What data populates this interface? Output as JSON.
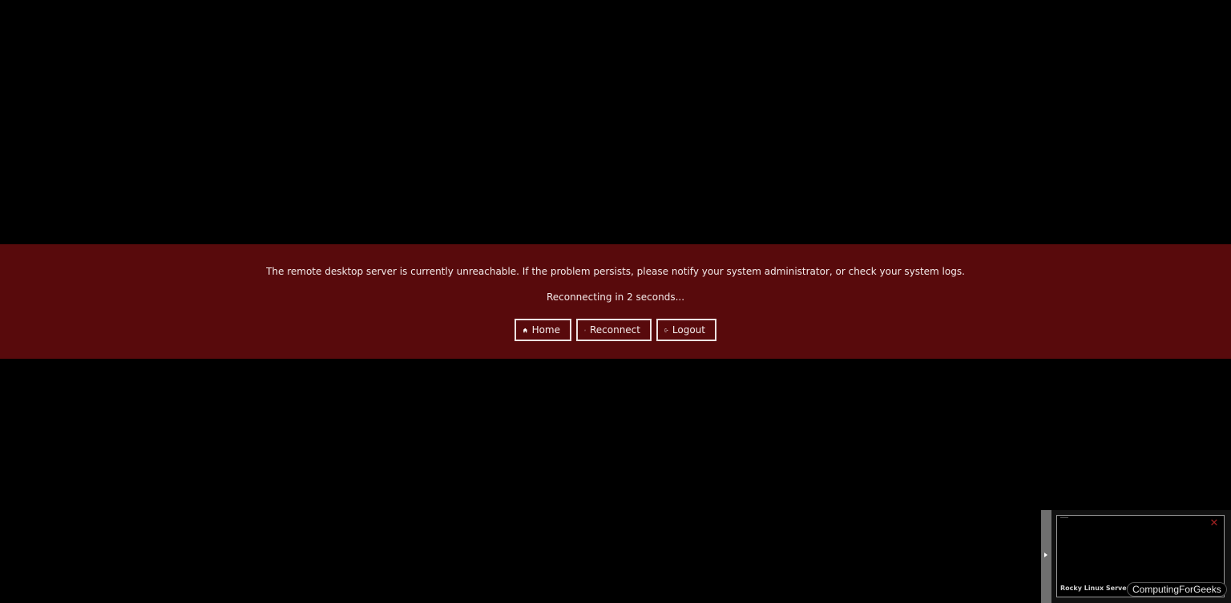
{
  "error": {
    "message": "The remote desktop server is currently unreachable. If the problem persists, please notify your system administrator, or check your system logs.",
    "status": "Reconnecting in 2 seconds...",
    "background_color": "#580a0c"
  },
  "buttons": {
    "home": {
      "label": "Home",
      "icon": "home-icon"
    },
    "reconnect": {
      "label": "Reconnect",
      "icon": "refresh-icon"
    },
    "logout": {
      "label": "Logout",
      "icon": "sign-out-icon"
    }
  },
  "connection_thumbnail": {
    "name": "Rocky Linux Server",
    "close_glyph": "✕"
  },
  "watermark": {
    "text": "ComputingForGeeks"
  }
}
